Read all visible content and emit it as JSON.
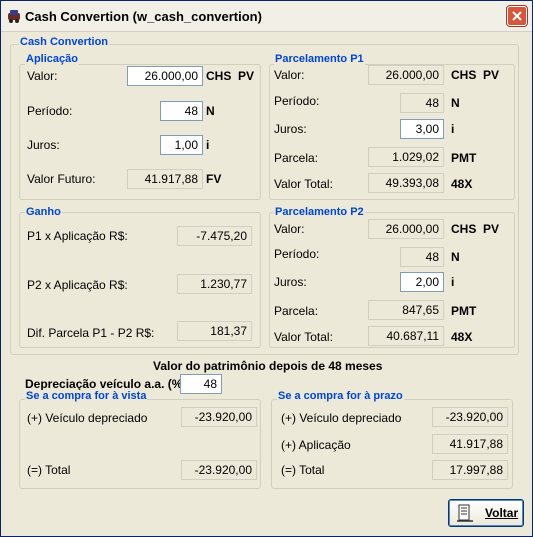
{
  "window": {
    "title": "Cash Convertion (w_cash_convertion)",
    "icon": "car-icon",
    "close_icon": "close-icon"
  },
  "main_group": {
    "label": "Cash Convertion"
  },
  "aplicacao": {
    "label": "Aplicação",
    "valor_label": "Valor:",
    "valor": "26.000,00",
    "valor_suffix": "CHS  PV",
    "periodo_label": "Período:",
    "periodo": "48",
    "periodo_suffix": "N",
    "juros_label": "Juros:",
    "juros": "1,00",
    "juros_suffix": "i",
    "fv_label": "Valor Futuro:",
    "fv": "41.917,88",
    "fv_suffix": "FV"
  },
  "p1": {
    "label": "Parcelamento P1",
    "valor_label": "Valor:",
    "valor": "26.000,00",
    "valor_suffix": "CHS  PV",
    "periodo_label": "Período:",
    "periodo": "48",
    "periodo_suffix": "N",
    "juros_label": "Juros:",
    "juros": "3,00",
    "juros_suffix": "i",
    "parcela_label": "Parcela:",
    "parcela": "1.029,02",
    "parcela_suffix": "PMT",
    "total_label": "Valor Total:",
    "total": "49.393,08",
    "total_suffix": "48X"
  },
  "ganho": {
    "label": "Ganho",
    "p1_label": "P1 x Aplicação  R$:",
    "p1": "-7.475,20",
    "p2_label": "P2 x Aplicação  R$:",
    "p2": "1.230,77",
    "dif_label": "Dif. Parcela P1 - P2 R$:",
    "dif": "181,37"
  },
  "p2": {
    "label": "Parcelamento P2",
    "valor_label": "Valor:",
    "valor": "26.000,00",
    "valor_suffix": "CHS  PV",
    "periodo_label": "Período:",
    "periodo": "48",
    "periodo_suffix": "N",
    "juros_label": "Juros:",
    "juros": "2,00",
    "juros_suffix": "i",
    "parcela_label": "Parcela:",
    "parcela": "847,65",
    "parcela_suffix": "PMT",
    "total_label": "Valor Total:",
    "total": "40.687,11",
    "total_suffix": "48X"
  },
  "patrimonio": {
    "heading": "Valor do patrimônio depois de 48 meses",
    "dep_label": "Depreciação veículo a.a. (%):",
    "dep": "48"
  },
  "vista": {
    "label": "Se a compra for à vista",
    "veiculo_label": "(+) Veículo depreciado",
    "veiculo": "-23.920,00",
    "total_label": "(=) Total",
    "total": "-23.920,00"
  },
  "prazo": {
    "label": "Se a compra for à prazo",
    "veiculo_label": "(+) Veículo depreciado",
    "veiculo": "-23.920,00",
    "aplicacao_label": "(+) Aplicação",
    "aplicacao": "41.917,88",
    "total_label": "(=) Total",
    "total": "17.997,88"
  },
  "footer": {
    "voltar_label": "Voltar",
    "voltar_icon": "exit-door-icon"
  }
}
